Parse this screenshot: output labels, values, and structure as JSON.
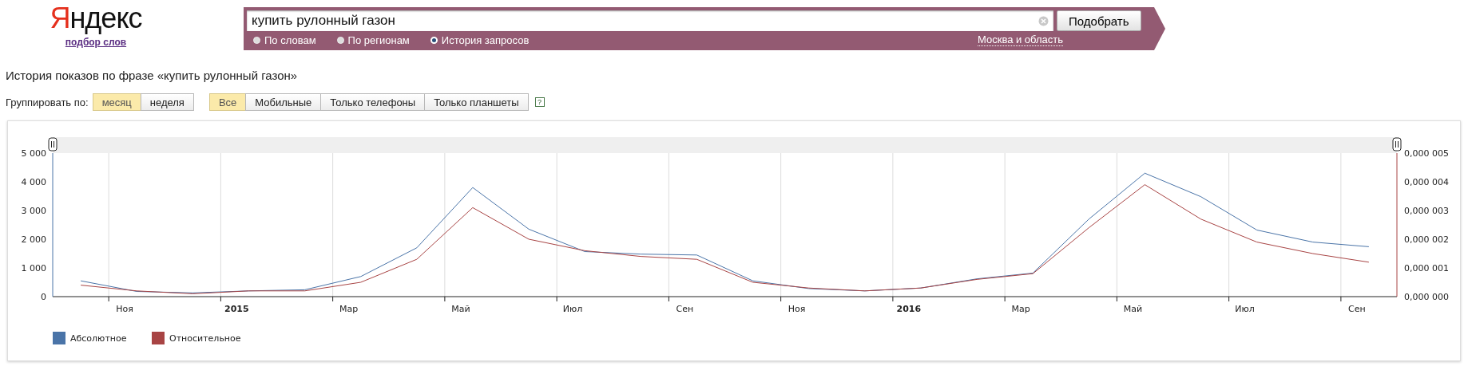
{
  "logo": {
    "text": "Яндекс",
    "subtitle": "подбор слов"
  },
  "search": {
    "value": "купить рулонный газон",
    "button": "Подобрать",
    "region": "Москва и область",
    "modes": [
      {
        "label": "По словам",
        "selected": false
      },
      {
        "label": "По регионам",
        "selected": false
      },
      {
        "label": "История запросов",
        "selected": true
      }
    ]
  },
  "heading": "История показов по фразе «купить рулонный газон»",
  "group_by": {
    "label": "Группировать по:",
    "options": [
      {
        "label": "месяц",
        "selected": true
      },
      {
        "label": "неделя",
        "selected": false
      }
    ]
  },
  "devices": [
    {
      "label": "Все",
      "selected": true
    },
    {
      "label": "Мобильные",
      "selected": false
    },
    {
      "label": "Только телефоны",
      "selected": false
    },
    {
      "label": "Только планшеты",
      "selected": false
    }
  ],
  "help": "?",
  "chart_data": {
    "type": "line",
    "categories": [
      null,
      "Ноя",
      null,
      "2015",
      null,
      "Мар",
      null,
      "Май",
      null,
      "Июл",
      null,
      "Сен",
      null,
      "Ноя",
      null,
      "2016",
      null,
      "Мар",
      null,
      "Май",
      null,
      "Июл",
      null,
      "Сен"
    ],
    "ylim": [
      0,
      5000
    ],
    "y2lim": [
      0,
      5e-06
    ],
    "legend": "bottom-left",
    "yticks": [
      {
        "value": 0,
        "label": "0"
      },
      {
        "value": 1000,
        "label": "1 000"
      },
      {
        "value": 2000,
        "label": "2 000"
      },
      {
        "value": 3000,
        "label": "3 000"
      },
      {
        "value": 4000,
        "label": "4 000"
      },
      {
        "value": 5000,
        "label": "5 000"
      }
    ],
    "y2ticks": [
      {
        "value": 0,
        "label": "0,000 000"
      },
      {
        "value": 1e-06,
        "label": "0,000 001"
      },
      {
        "value": 2e-06,
        "label": "0,000 002"
      },
      {
        "value": 3e-06,
        "label": "0,000 003"
      },
      {
        "value": 4e-06,
        "label": "0,000 004"
      },
      {
        "value": 5e-06,
        "label": "0,000 005"
      }
    ],
    "series": [
      {
        "name": "Абсолютное",
        "color": "#4a74a8",
        "values": [
          550,
          180,
          130,
          200,
          240,
          700,
          1700,
          3800,
          2350,
          1570,
          1480,
          1450,
          550,
          280,
          200,
          300,
          620,
          820,
          2700,
          4300,
          3480,
          2320,
          1900,
          1740
        ]
      },
      {
        "name": "Относительное",
        "color": "#a84444",
        "axis": "y2",
        "values": [
          4e-07,
          2e-07,
          1e-07,
          2e-07,
          2e-07,
          5e-07,
          1.3e-06,
          3.1e-06,
          2e-06,
          1.6e-06,
          1.4e-06,
          1.3e-06,
          5e-07,
          3e-07,
          2e-07,
          3e-07,
          6e-07,
          8e-07,
          2.4e-06,
          3.9e-06,
          2.7e-06,
          1.9e-06,
          1.5e-06,
          1.2e-06
        ]
      }
    ]
  }
}
